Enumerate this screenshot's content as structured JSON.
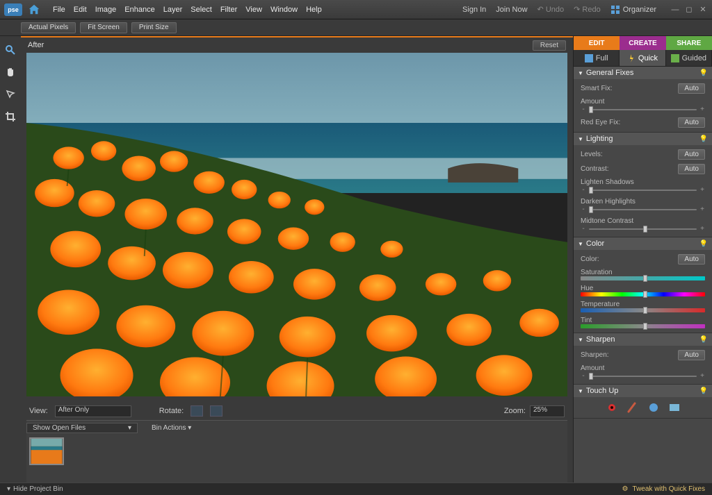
{
  "app_logo": "pse",
  "menu": [
    "File",
    "Edit",
    "Image",
    "Enhance",
    "Layer",
    "Select",
    "Filter",
    "View",
    "Window",
    "Help"
  ],
  "menubar_right": {
    "sign_in": "Sign In",
    "join_now": "Join Now",
    "undo": "Undo",
    "redo": "Redo",
    "organizer": "Organizer"
  },
  "toolbar": {
    "actual_pixels": "Actual Pixels",
    "fit_screen": "Fit Screen",
    "print_size": "Print Size"
  },
  "canvas": {
    "after_label": "After",
    "reset": "Reset"
  },
  "view_controls": {
    "view_label": "View:",
    "view_value": "After Only",
    "rotate_label": "Rotate:",
    "zoom_label": "Zoom:",
    "zoom_value": "25%"
  },
  "bin": {
    "show_open": "Show Open Files",
    "bin_actions": "Bin Actions"
  },
  "mode_tabs": {
    "edit": "EDIT",
    "create": "CREATE",
    "share": "SHARE"
  },
  "sub_tabs": {
    "full": "Full",
    "quick": "Quick",
    "guided": "Guided"
  },
  "panels": {
    "general": {
      "title": "General Fixes",
      "smart_fix": "Smart Fix:",
      "amount": "Amount",
      "red_eye": "Red Eye Fix:",
      "auto": "Auto"
    },
    "lighting": {
      "title": "Lighting",
      "levels": "Levels:",
      "contrast": "Contrast:",
      "lighten": "Lighten Shadows",
      "darken": "Darken Highlights",
      "midtone": "Midtone Contrast",
      "auto": "Auto"
    },
    "color": {
      "title": "Color",
      "color": "Color:",
      "saturation": "Saturation",
      "hue": "Hue",
      "temperature": "Temperature",
      "tint": "Tint",
      "auto": "Auto"
    },
    "sharpen": {
      "title": "Sharpen",
      "sharpen": "Sharpen:",
      "amount": "Amount",
      "auto": "Auto"
    },
    "touchup": {
      "title": "Touch Up"
    }
  },
  "statusbar": {
    "hide_bin": "Hide Project Bin",
    "tweak": "Tweak with Quick Fixes"
  }
}
